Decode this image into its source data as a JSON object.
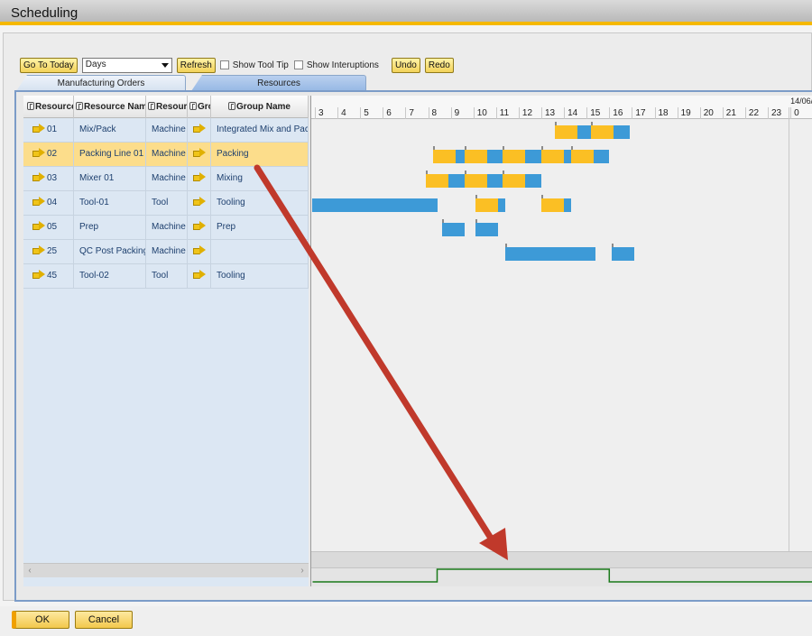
{
  "window": {
    "title": "Scheduling"
  },
  "toolbar": {
    "go_to_today": "Go To Today",
    "view_mode": "Days",
    "refresh": "Refresh",
    "show_tool_tip": "Show Tool Tip",
    "show_interruptions": "Show Interuptions",
    "undo": "Undo",
    "redo": "Redo"
  },
  "tabs": {
    "manufacturing_orders": "Manufacturing Orders",
    "resources": "Resources"
  },
  "grid": {
    "columns": [
      "Resource",
      "Resource Name",
      "Resource",
      "Gro",
      "Group Name"
    ],
    "rows": [
      {
        "code": "01",
        "name": "Mix/Pack",
        "type": "Machine",
        "group": "Integrated Mix and Pack"
      },
      {
        "code": "02",
        "name": "Packing Line 01",
        "type": "Machine",
        "group": "Packing"
      },
      {
        "code": "03",
        "name": "Mixer 01",
        "type": "Machine",
        "group": "Mixing"
      },
      {
        "code": "04",
        "name": "Tool-01",
        "type": "Tool",
        "group": "Tooling"
      },
      {
        "code": "05",
        "name": "Prep",
        "type": "Machine",
        "group": "Prep"
      },
      {
        "code": "25",
        "name": "QC Post Packing",
        "type": "Machine",
        "group": ""
      },
      {
        "code": "45",
        "name": "Tool-02",
        "type": "Tool",
        "group": "Tooling"
      }
    ]
  },
  "gantt": {
    "date_label": "14/06/",
    "hours": [
      "3",
      "4",
      "5",
      "6",
      "7",
      "8",
      "9",
      "10",
      "11",
      "12",
      "13",
      "14",
      "15",
      "16",
      "17",
      "18",
      "19",
      "20",
      "21",
      "22",
      "23",
      "0"
    ],
    "first_hour": 3,
    "bars": [
      {
        "row": 0,
        "start": 13.6,
        "end": 14.6,
        "color": "yellow",
        "tick": true
      },
      {
        "row": 0,
        "start": 14.6,
        "end": 15.2,
        "color": "blue"
      },
      {
        "row": 0,
        "start": 15.2,
        "end": 16.2,
        "color": "yellow",
        "tick": true
      },
      {
        "row": 0,
        "start": 16.2,
        "end": 16.9,
        "color": "blue"
      },
      {
        "row": 1,
        "start": 8.2,
        "end": 9.2,
        "color": "yellow",
        "tick": true
      },
      {
        "row": 1,
        "start": 9.2,
        "end": 9.6,
        "color": "blue"
      },
      {
        "row": 1,
        "start": 9.6,
        "end": 10.6,
        "color": "yellow",
        "tick": true
      },
      {
        "row": 1,
        "start": 10.6,
        "end": 11.3,
        "color": "blue"
      },
      {
        "row": 1,
        "start": 11.3,
        "end": 12.3,
        "color": "yellow",
        "tick": true
      },
      {
        "row": 1,
        "start": 12.3,
        "end": 13.0,
        "color": "blue"
      },
      {
        "row": 1,
        "start": 13.0,
        "end": 14.0,
        "color": "yellow",
        "tick": true
      },
      {
        "row": 1,
        "start": 14.0,
        "end": 14.3,
        "color": "blue"
      },
      {
        "row": 1,
        "start": 14.3,
        "end": 15.3,
        "color": "yellow",
        "tick": true
      },
      {
        "row": 1,
        "start": 15.3,
        "end": 16.0,
        "color": "blue"
      },
      {
        "row": 2,
        "start": 7.9,
        "end": 8.9,
        "color": "yellow",
        "tick": true
      },
      {
        "row": 2,
        "start": 8.9,
        "end": 9.6,
        "color": "blue"
      },
      {
        "row": 2,
        "start": 9.6,
        "end": 10.6,
        "color": "yellow",
        "tick": true
      },
      {
        "row": 2,
        "start": 10.6,
        "end": 11.3,
        "color": "blue"
      },
      {
        "row": 2,
        "start": 11.3,
        "end": 12.3,
        "color": "yellow",
        "tick": true
      },
      {
        "row": 2,
        "start": 12.3,
        "end": 13.0,
        "color": "blue"
      },
      {
        "row": 3,
        "start": 2.9,
        "end": 8.4,
        "color": "blue"
      },
      {
        "row": 3,
        "start": 10.1,
        "end": 11.1,
        "color": "yellow",
        "tick": true
      },
      {
        "row": 3,
        "start": 11.1,
        "end": 11.4,
        "color": "blue"
      },
      {
        "row": 3,
        "start": 13.0,
        "end": 14.0,
        "color": "yellow",
        "tick": true
      },
      {
        "row": 3,
        "start": 14.0,
        "end": 14.3,
        "color": "blue"
      },
      {
        "row": 4,
        "start": 8.6,
        "end": 9.6,
        "color": "blue",
        "tick": true
      },
      {
        "row": 4,
        "start": 10.1,
        "end": 11.1,
        "color": "blue",
        "tick": true
      },
      {
        "row": 5,
        "start": 11.4,
        "end": 15.4,
        "color": "blue",
        "tick": true
      },
      {
        "row": 5,
        "start": 16.1,
        "end": 17.1,
        "color": "blue",
        "tick": true
      }
    ],
    "load_profile": [
      [
        2.9,
        0
      ],
      [
        8.4,
        0
      ],
      [
        8.4,
        1
      ],
      [
        16.0,
        1
      ],
      [
        16.0,
        0
      ],
      [
        25,
        0
      ]
    ]
  },
  "colors": {
    "bar_yellow": "#fbbf24",
    "bar_blue": "#3d9ad7",
    "selection": "#fcdd8b",
    "annotation_arrow": "#c0392b",
    "load_line": "#1a7a1a"
  },
  "footer": {
    "ok": "OK",
    "cancel": "Cancel"
  }
}
